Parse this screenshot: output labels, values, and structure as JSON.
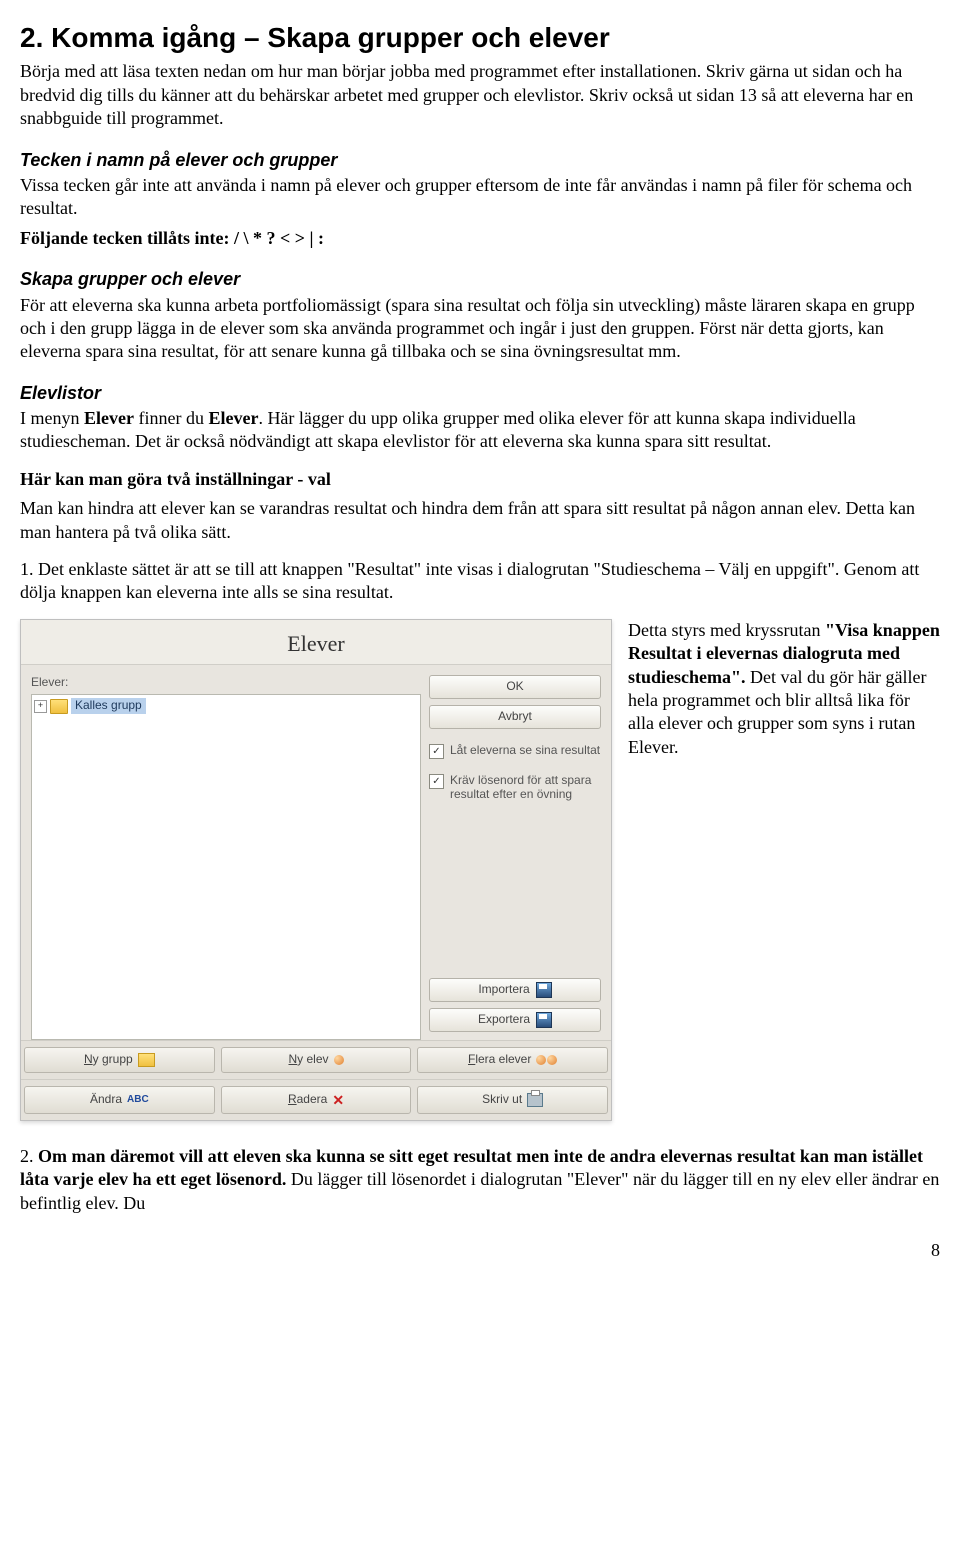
{
  "title": "2. Komma igång – Skapa grupper och elever",
  "intro": "Börja med att läsa texten nedan om hur man börjar jobba med programmet efter installationen. Skriv gärna ut sidan och ha bredvid dig tills du känner att du behärskar arbetet med grupper och elevlistor. Skriv också ut sidan 13 så att eleverna har en snabbguide till programmet.",
  "tecken_heading": "Tecken i namn på elever och grupper",
  "tecken_body": "Vissa tecken går inte att använda i namn på elever och grupper eftersom de inte får användas i namn på filer för schema och resultat.",
  "tecken_disallow": "Följande tecken tillåts inte: / \\ * ? < > | :",
  "skapa_heading": "Skapa grupper och elever",
  "skapa_body": "För att eleverna ska kunna arbeta portfoliomässigt (spara sina resultat och följa sin utveckling) måste läraren skapa en grupp och i den grupp lägga in de elever som ska använda programmet och ingår i just den gruppen. Först när detta gjorts, kan eleverna spara sina resultat, för att senare kunna gå tillbaka och se sina övningsresultat mm.",
  "elevlistor_heading": "Elevlistor",
  "elevlistor_body": "I menyn Elever finner du Elever. Här lägger du upp olika grupper med olika elever för att kunna skapa individuella studiescheman. Det är också nödvändigt att skapa elevlistor för att eleverna ska kunna spara sitt resultat.",
  "elevlistor_b1": "Elever",
  "elevlistor_b2": "Elever",
  "tvaval_heading": "Här kan man göra två inställningar - val",
  "tvaval_body": "Man kan hindra att elever kan se varandras resultat och hindra dem från att spara sitt resultat på någon annan elev. Detta kan man hantera på två olika sätt.",
  "opt1": "1. Det enklaste sättet är att se till att knappen \"Resultat\" inte visas i dialogrutan \"Studieschema – Välj en uppgift\". Genom att dölja knappen kan eleverna inte alls se sina resultat.",
  "right_para_prefix": "Detta styrs med kryssrutan ",
  "right_para_bold": "\"Visa knappen Resultat i elevernas dialogruta med studieschema\".",
  "right_para_suffix": " Det val du gör här gäller hela programmet och blir alltså lika för alla elever och grupper som syns i rutan Elever.",
  "opt2_prefix": "2. ",
  "opt2_bold": "Om man däremot vill att eleven ska kunna se sitt eget resultat men inte de andra elevernas resultat kan man istället låta varje elev ha ett eget lösenord.",
  "opt2_suffix": " Du lägger till lösenordet i dialogrutan \"Elever\" när du lägger till en ny elev eller ändrar en befintlig elev. Du",
  "page": "8",
  "dialog": {
    "title": "Elever",
    "list_label": "Elever:",
    "group": "Kalles grupp",
    "ok": "OK",
    "cancel": "Avbryt",
    "chk1": "Låt eleverna se sina resultat",
    "chk2": "Kräv lösenord för att spara resultat efter en övning",
    "import": "Importera",
    "export": "Exportera",
    "b_nygrupp": "Ny grupp",
    "b_nyelev": "Ny elev",
    "b_flera": "Flera elever",
    "b_andra": "Ändra",
    "b_radera": "Radera",
    "b_skriv": "Skriv ut"
  }
}
